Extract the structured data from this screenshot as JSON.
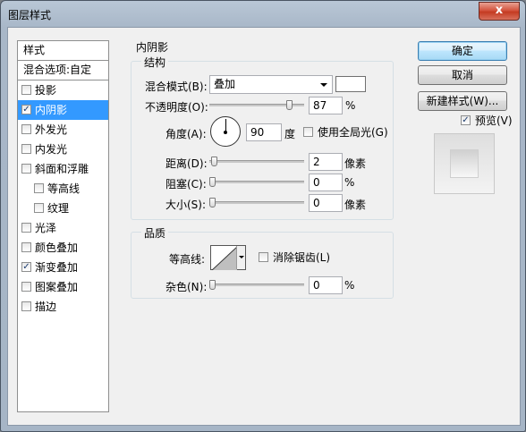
{
  "window": {
    "title": "图层样式",
    "close_label": "x"
  },
  "style_list": {
    "header": "样式",
    "blend_options": "混合选项:自定",
    "items": [
      {
        "label": "投影",
        "checked": false,
        "sub": false,
        "selected": false
      },
      {
        "label": "内阴影",
        "checked": true,
        "sub": false,
        "selected": true
      },
      {
        "label": "外发光",
        "checked": false,
        "sub": false,
        "selected": false
      },
      {
        "label": "内发光",
        "checked": false,
        "sub": false,
        "selected": false
      },
      {
        "label": "斜面和浮雕",
        "checked": false,
        "sub": false,
        "selected": false
      },
      {
        "label": "等高线",
        "checked": false,
        "sub": true,
        "selected": false
      },
      {
        "label": "纹理",
        "checked": false,
        "sub": true,
        "selected": false
      },
      {
        "label": "光泽",
        "checked": false,
        "sub": false,
        "selected": false
      },
      {
        "label": "颜色叠加",
        "checked": false,
        "sub": false,
        "selected": false
      },
      {
        "label": "渐变叠加",
        "checked": true,
        "sub": false,
        "selected": false
      },
      {
        "label": "图案叠加",
        "checked": false,
        "sub": false,
        "selected": false
      },
      {
        "label": "描边",
        "checked": false,
        "sub": false,
        "selected": false
      }
    ]
  },
  "inner_shadow": {
    "section_title": "内阴影",
    "structure": {
      "title": "结构",
      "blend_mode_label": "混合模式(B):",
      "blend_mode_value": "叠加",
      "swatch_color": "#ffffff",
      "opacity_label": "不透明度(O):",
      "opacity_value": "87",
      "opacity_unit": "%",
      "angle_label": "角度(A):",
      "angle_value": "90",
      "angle_unit": "度",
      "global_light_label": "使用全局光(G)",
      "global_light_checked": false,
      "distance_label": "距离(D):",
      "distance_value": "2",
      "distance_unit": "像素",
      "choke_label": "阻塞(C):",
      "choke_value": "0",
      "choke_unit": "%",
      "size_label": "大小(S):",
      "size_value": "0",
      "size_unit": "像素"
    },
    "quality": {
      "title": "品质",
      "contour_label": "等高线:",
      "anti_alias_label": "消除锯齿(L)",
      "anti_alias_checked": false,
      "noise_label": "杂色(N):",
      "noise_value": "0",
      "noise_unit": "%"
    }
  },
  "buttons": {
    "ok": "确定",
    "cancel": "取消",
    "new_style": "新建样式(W)...",
    "preview_label": "预览(V)",
    "preview_checked": true
  }
}
